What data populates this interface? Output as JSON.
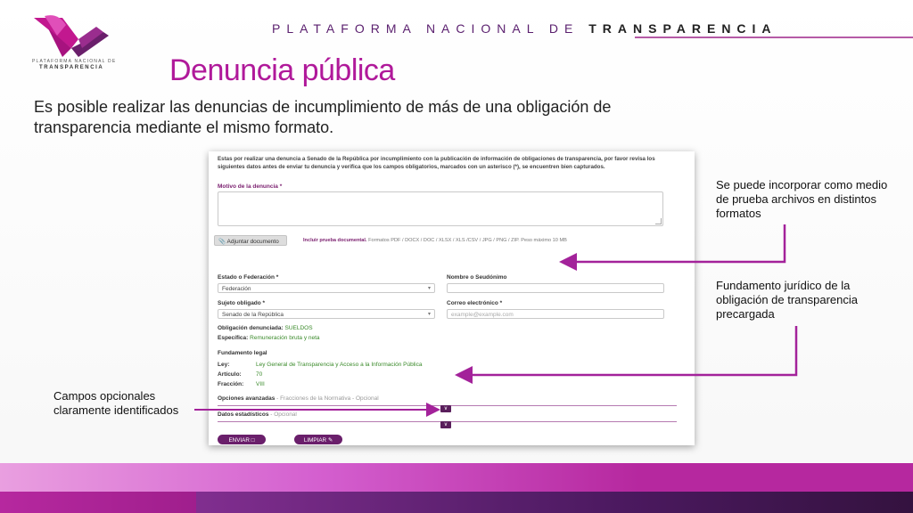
{
  "header": {
    "logo_line1": "PLATAFORMA NACIONAL DE",
    "logo_line2": "TRANSPARENCIA",
    "brand_prefix": "PLATAFORMA NACIONAL DE",
    "brand_strong": "TRANSPARENCIA"
  },
  "title": "Denuncia pública",
  "lead": "Es posible realizar las denuncias de incumplimiento de más de una obligación de transparencia mediante el mismo formato.",
  "form": {
    "intro": "Estas por realizar una denuncia a Senado de la República por incumplimiento con la publicación de información de obligaciones de transparencia, por favor revisa los siguientes datos antes de enviar tu denuncia y verifica que los campos obligatorios, marcados con un asterisco (*), se encuentren bien capturados.",
    "motivo_label": "Motivo de la denuncia *",
    "attach_label": "Adjuntar documento",
    "attach_note_strong": "Incluir prueba documental.",
    "attach_note": "Formatos PDF / DOCX / DOC / XLSX / XLS /CSV / JPG / PNG / ZIP. Peso máximo 10 MB",
    "estado_label": "Estado o Federación *",
    "estado_value": "Federación",
    "nombre_label": "Nombre o Seudónimo",
    "sujeto_label": "Sujeto obligado *",
    "sujeto_value": "Senado de la República",
    "correo_label": "Correo electrónico *",
    "correo_placeholder": "example@example.com",
    "obligacion_key": "Obligación denunciada:",
    "obligacion_value": "SUELDOS",
    "especifica_key": "Específica:",
    "especifica_value": "Remuneración bruta y neta",
    "legal_title": "Fundamento legal",
    "ley_key": "Ley:",
    "ley_value": "Ley General de Transparencia y Acceso a la Información Pública",
    "articulo_key": "Artículo:",
    "articulo_value": "70",
    "fraccion_key": "Fracción:",
    "fraccion_value": "VIII",
    "opciones_label": "Opciones avanzadas",
    "opciones_opt": " - Fracciones de la Normativa - Opcional",
    "datos_label": "Datos estadísticos",
    "datos_opt": " - Opcional",
    "enviar_label": "ENVIAR",
    "limpiar_label": "LIMPIAR"
  },
  "annotations": {
    "formats": "Se puede incorporar como medio de prueba archivos en distintos formatos",
    "legal": "Fundamento jurídico de la obligación de transparencia precargada",
    "optional": "Campos opcionales claramente identificados"
  },
  "colors": {
    "accent": "#b0199a",
    "arrow": "#a3229a",
    "button": "#6a1f6b"
  }
}
